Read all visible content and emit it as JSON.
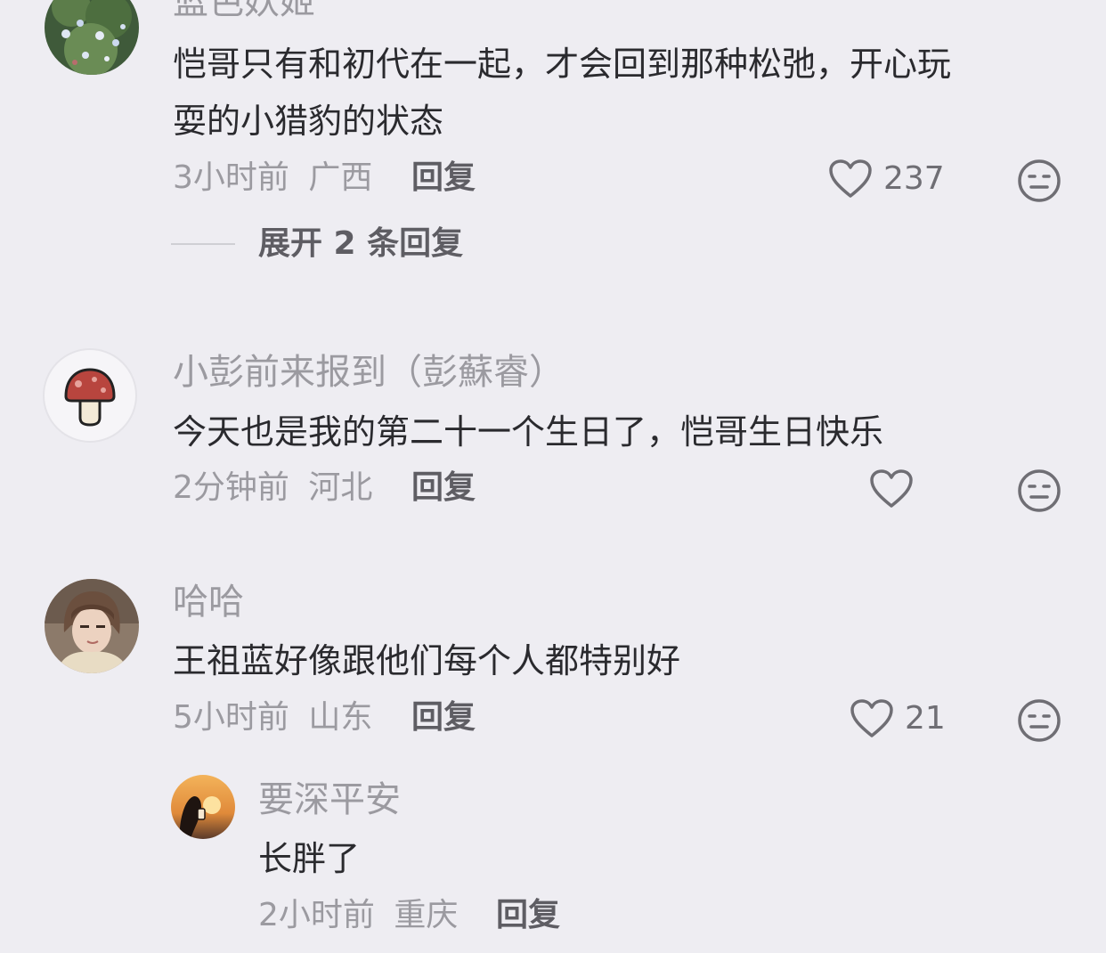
{
  "comments": [
    {
      "username": "蓝色妖姬",
      "text_lines": [
        "恺哥只有和初代在一起，才会回到那种松弛，开心玩",
        "耍的小猎豹的状态"
      ],
      "time": "3小时前",
      "location": "广西",
      "reply_label": "回复",
      "likes": "237",
      "avatar_icon": "flower-bush-icon",
      "expand_label": "展开 2 条回复"
    },
    {
      "username": "小彭前来报到（彭蘇睿）",
      "text_lines": [
        "今天也是我的第二十一个生日了，恺哥生日快乐"
      ],
      "time": "2分钟前",
      "location": "河北",
      "reply_label": "回复",
      "likes": "",
      "avatar_icon": "mushroom-icon"
    },
    {
      "username": "哈哈",
      "text_lines": [
        "王祖蓝好像跟他们每个人都特别好"
      ],
      "time": "5小时前",
      "location": "山东",
      "reply_label": "回复",
      "likes": "21",
      "avatar_icon": "person-photo-icon"
    }
  ],
  "sub_reply": {
    "username": "要深平安",
    "text": "长胖了",
    "time": "2小时前",
    "location": "重庆",
    "reply_label": "回复",
    "avatar_icon": "sunset-photo-icon"
  },
  "colors": {
    "background": "#eeedf2",
    "text": "#2a2a2e",
    "muted": "#9b9aa0",
    "icon": "#6f6e74"
  }
}
